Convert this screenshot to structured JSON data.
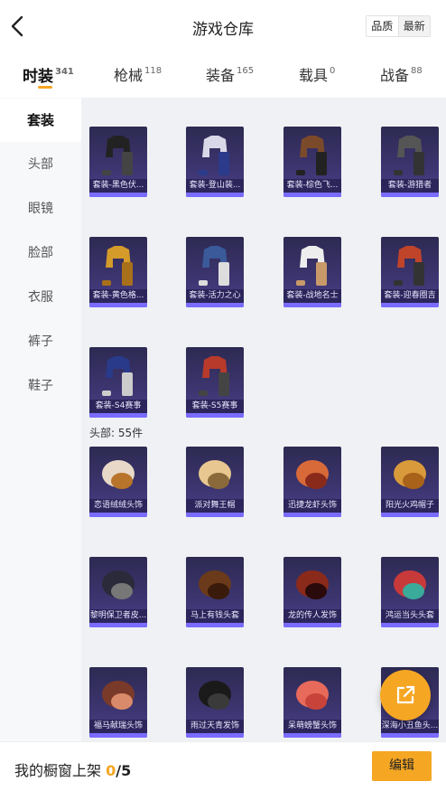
{
  "header": {
    "title": "游戏仓库",
    "sort_options": [
      "品质",
      "最新"
    ]
  },
  "tabs": [
    {
      "label": "时装",
      "count": "341"
    },
    {
      "label": "枪械",
      "count": "118"
    },
    {
      "label": "装备",
      "count": "165"
    },
    {
      "label": "载具",
      "count": "0"
    },
    {
      "label": "战备",
      "count": "88"
    }
  ],
  "sidebar": {
    "items": [
      "套装",
      "头部",
      "眼镜",
      "脸部",
      "衣服",
      "裤子",
      "鞋子"
    ]
  },
  "sections": {
    "head_label": "头部: 55件"
  },
  "suits": [
    {
      "name": "套装-黑色伏...",
      "icon": "black-suit-icon"
    },
    {
      "name": "套装-登山装...",
      "icon": "climbing-suit-icon"
    },
    {
      "name": "套装-棕色飞...",
      "icon": "brown-flight-suit-icon"
    },
    {
      "name": "套装-游猎者",
      "icon": "safari-suit-icon"
    },
    {
      "name": "套装-黄色格...",
      "icon": "yellow-suit-icon"
    },
    {
      "name": "套装-活力之心",
      "icon": "vitality-suit-icon"
    },
    {
      "name": "套装-战地名士",
      "icon": "field-suit-icon"
    },
    {
      "name": "套装-迎春圈吉",
      "icon": "spring-suit-icon"
    },
    {
      "name": "套装-S4赛事",
      "icon": "s4-suit-icon"
    },
    {
      "name": "套装-S5赛事",
      "icon": "s5-suit-icon"
    }
  ],
  "heads": [
    {
      "name": "恋语绒绒头饰",
      "icon": "fluffy-headwear-icon"
    },
    {
      "name": "派对舞王帽",
      "icon": "party-cap-icon"
    },
    {
      "name": "迅捷龙虾头饰",
      "icon": "lobster-headwear-icon"
    },
    {
      "name": "阳光火鸡帽子",
      "icon": "turkey-hat-icon"
    },
    {
      "name": "黎明保卫者皮...",
      "icon": "leather-cap-icon"
    },
    {
      "name": "马上有钱头套",
      "icon": "horse-mask-icon"
    },
    {
      "name": "龙的传人发饰",
      "icon": "dragon-hair-icon"
    },
    {
      "name": "鸿运当头头套",
      "icon": "lion-mask-icon"
    },
    {
      "name": "福马献瑞头饰",
      "icon": "horse-headwear-icon"
    },
    {
      "name": "雨过天青发饰",
      "icon": "black-hair-icon"
    },
    {
      "name": "呆萌螃蟹头饰",
      "icon": "crab-headwear-icon"
    },
    {
      "name": "深海小丑鱼头...",
      "icon": "clownfish-headwear-icon"
    }
  ],
  "footer": {
    "label": "我的橱窗上架",
    "current": "0",
    "total": "/5",
    "edit_label": "编辑"
  },
  "colors": {
    "accent": "#f5a623",
    "card_bg": "#3d3570",
    "card_bar": "#7a6cff",
    "content_bg": "#eff1f4"
  }
}
